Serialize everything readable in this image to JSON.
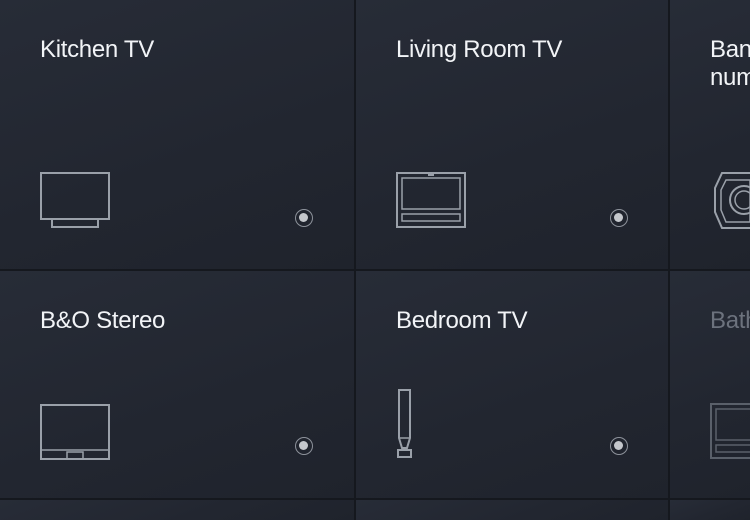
{
  "devices": [
    {
      "name": "Kitchen TV",
      "icon": "tv-icon"
    },
    {
      "name": "Living Room TV",
      "icon": "tv-soundbar-icon"
    },
    {
      "name": "Ban\nnum",
      "icon": "speaker-icon"
    },
    {
      "name": "B&O Stereo",
      "icon": "tv-icon"
    },
    {
      "name": "Bedroom TV",
      "icon": "floor-speaker-icon"
    },
    {
      "name": "Bath",
      "icon": "tv-soundbar-icon"
    }
  ],
  "colors": {
    "background": "#1e222b",
    "text": "#f2f4f7",
    "text_dim": "#6c727d",
    "icon_stroke": "#9aa0a9",
    "status_dot": "#c4c7cc"
  }
}
